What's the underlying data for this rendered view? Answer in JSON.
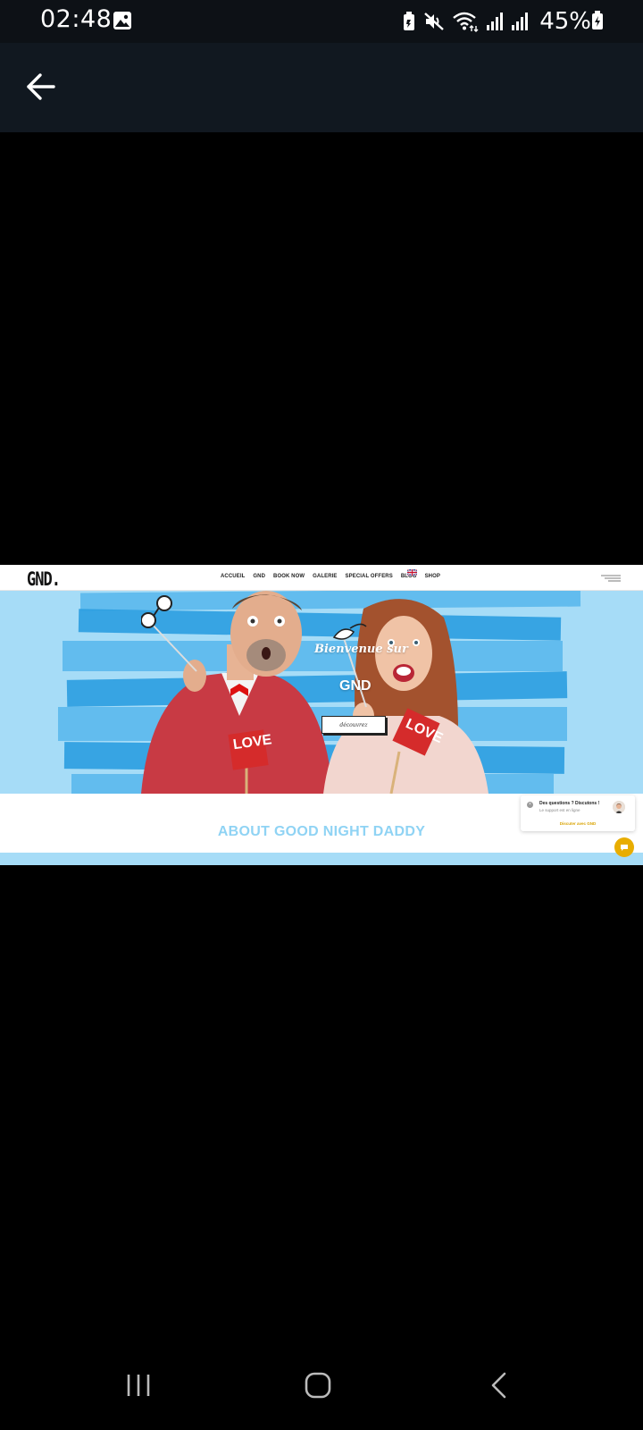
{
  "status_bar": {
    "time": "02:48",
    "battery": "45%",
    "icons": [
      "gallery-icon",
      "battery-saver-icon",
      "mute-icon",
      "wifi-icon",
      "signal-icon",
      "signal-icon",
      "battery-charging-icon"
    ]
  },
  "app_bar": {
    "back_icon": "back-arrow-icon"
  },
  "website": {
    "logo": "GND.",
    "nav": [
      "ACCUEIL",
      "GND",
      "BOOK NOW",
      "GALERIE",
      "SPECIAL OFFERS",
      "BLOG",
      "SHOP"
    ],
    "language_icon": "uk-flag-icon",
    "menu_icon": "hamburger-icon",
    "hero": {
      "title": "Bienvenue sur",
      "brand": "GND",
      "button": "découvrez",
      "sign_text": "LOVE"
    },
    "about_title": "ABOUT GOOD NIGHT DADDY",
    "chat": {
      "title": "Des questions ? Discutons !",
      "subtitle": "Le support est en ligne",
      "link": "Discuter avec GND",
      "bubble_icon": "chat-bubble-icon"
    },
    "colors": {
      "sky": "#a6dcf7",
      "stripe": "#2b9de0",
      "about": "#8fd3f4",
      "chat_accent": "#e8ad00"
    }
  },
  "nav_bar": {
    "icons": [
      "recent-apps-icon",
      "home-icon",
      "back-icon"
    ]
  }
}
